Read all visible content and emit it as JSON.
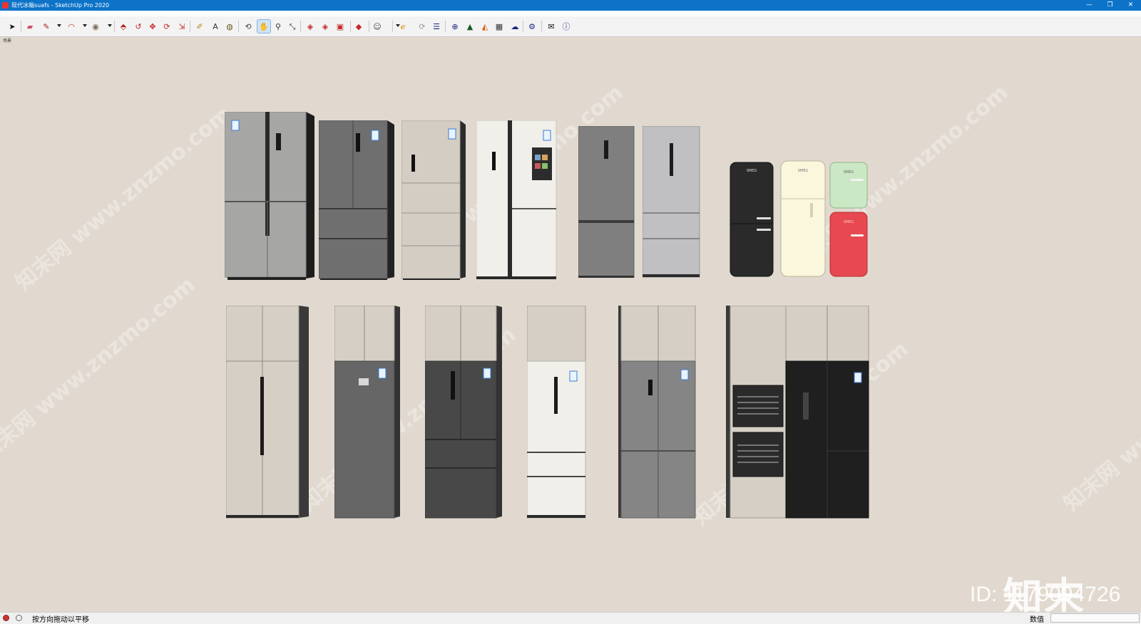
{
  "window": {
    "title": "现代冰箱suafs - SketchUp Pro 2020",
    "controls": [
      "—",
      "❐",
      "✕"
    ]
  },
  "toolbar": {
    "tools": [
      {
        "name": "select-tool",
        "glyph": "➤",
        "color": "#111"
      },
      {
        "name": "eraser-tool",
        "glyph": "▰",
        "color": "#d0506b"
      },
      {
        "name": "line-tool",
        "glyph": "✎",
        "color": "#b71c1c"
      },
      {
        "name": "arc-tool",
        "glyph": "◠",
        "color": "#c62828"
      },
      {
        "name": "shape-tool",
        "glyph": "◉",
        "color": "#7a6a55"
      },
      {
        "name": "push-pull-tool",
        "glyph": "⬘",
        "color": "#b71c1c"
      },
      {
        "name": "follow-me-tool",
        "glyph": "↺",
        "color": "#c62828"
      },
      {
        "name": "move-tool",
        "glyph": "✥",
        "color": "#c62828"
      },
      {
        "name": "rotate-tool",
        "glyph": "⟳",
        "color": "#c62828"
      },
      {
        "name": "scale-tool",
        "glyph": "⇲",
        "color": "#c62828"
      },
      {
        "name": "tape-measure-tool",
        "glyph": "✐",
        "color": "#b8860b"
      },
      {
        "name": "text-tool",
        "glyph": "A",
        "color": "#333"
      },
      {
        "name": "paint-bucket-tool",
        "glyph": "◍",
        "color": "#6b5a1e"
      },
      {
        "name": "orbit-tool",
        "glyph": "⟲",
        "color": "#444"
      },
      {
        "name": "pan-tool",
        "glyph": "✋",
        "color": "#444"
      },
      {
        "name": "zoom-tool",
        "glyph": "⚲",
        "color": "#333"
      },
      {
        "name": "zoom-extents-tool",
        "glyph": "⤡",
        "color": "#333"
      },
      {
        "name": "warehouse-tool",
        "glyph": "◈",
        "color": "#c62828"
      },
      {
        "name": "extension-warehouse-tool",
        "glyph": "◈",
        "color": "#c62828"
      },
      {
        "name": "send-to-layout-tool",
        "glyph": "▣",
        "color": "#c62828"
      },
      {
        "name": "extension-manager-tool",
        "glyph": "◆",
        "color": "#c62828"
      },
      {
        "name": "account-tool",
        "glyph": "☺",
        "color": "#444"
      },
      {
        "name": "plugin-e-tool",
        "glyph": "ℯ",
        "color": "#e08a00"
      },
      {
        "name": "refresh-tool",
        "glyph": "⟳",
        "color": "#999"
      },
      {
        "name": "layers-tool",
        "glyph": "☰",
        "color": "#1a237e"
      },
      {
        "name": "add-tool",
        "glyph": "⊕",
        "color": "#1a237e"
      },
      {
        "name": "tree-tool",
        "glyph": "▲",
        "color": "#1b5e20"
      },
      {
        "name": "terrain-tool",
        "glyph": "◭",
        "color": "#e65100"
      },
      {
        "name": "checker-tool",
        "glyph": "▦",
        "color": "#333"
      },
      {
        "name": "cloud-tool",
        "glyph": "☁",
        "color": "#1a237e"
      },
      {
        "name": "settings-tool",
        "glyph": "⚙",
        "color": "#1a237e"
      },
      {
        "name": "mail-tool",
        "glyph": "✉",
        "color": "#111"
      },
      {
        "name": "info-tool",
        "glyph": "ⓘ",
        "color": "#1a237e"
      }
    ]
  },
  "scene": {
    "tab_label": "场景",
    "watermark_text": "知末网 www.znzmo.com",
    "logo_text": "知末",
    "id_text": "ID: 1179094726"
  },
  "colors": {
    "background": "#e1d9cf",
    "titlebar": "#0d73c9"
  },
  "statusbar": {
    "message": "按方向拖动以平移",
    "value_label": "数值",
    "value": ""
  }
}
